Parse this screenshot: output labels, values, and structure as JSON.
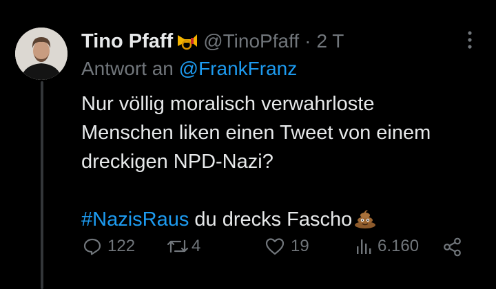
{
  "tweet": {
    "display_name": "Tino Pfaff",
    "name_emoji": "postal-horn-emoji",
    "handle": "@TinoPfaff",
    "separator": "·",
    "time": "2 T",
    "reply_prefix": "Antwort an",
    "reply_handle": "@FrankFranz",
    "text_line1": "Nur völlig moralisch verwahrloste",
    "text_line2": "Menschen liken einen Tweet von einem",
    "text_line3": "dreckigen NPD-Nazi?",
    "hashtag": "#NazisRaus",
    "text_after_hashtag": " du drecks Fascho",
    "trailing_emoji": "pile-of-poo-emoji"
  },
  "actions": {
    "replies": "122",
    "retweets": "4",
    "likes": "19",
    "views": "6.160"
  },
  "colors": {
    "background": "#000000",
    "text": "#e7e9ea",
    "muted": "#71767b",
    "link": "#1d9bf0",
    "thread_line": "#333639"
  }
}
